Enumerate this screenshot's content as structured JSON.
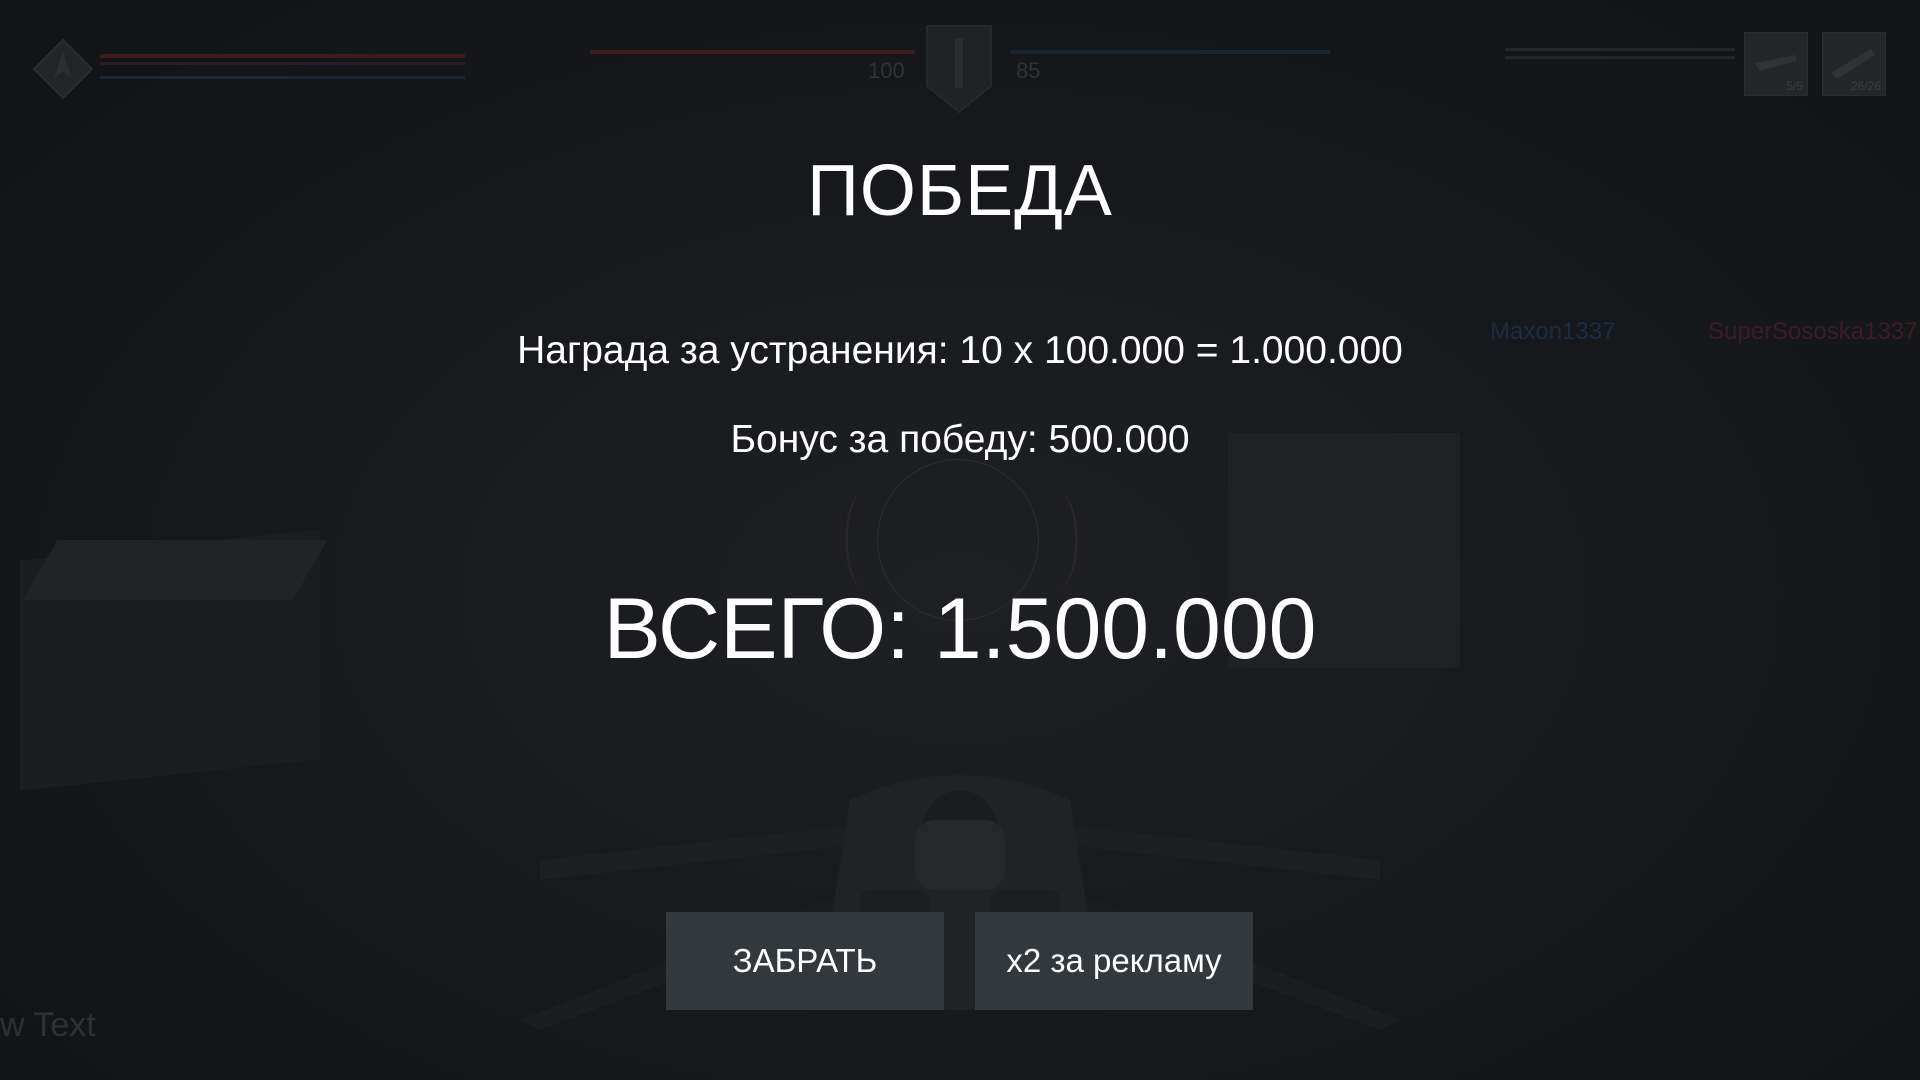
{
  "hud": {
    "team_red_score": "100",
    "team_blue_score": "85",
    "weapon_slots": [
      {
        "icon": "rifle-icon",
        "count": "5/5"
      },
      {
        "icon": "missile-icon",
        "count": "26/26"
      }
    ]
  },
  "scene": {
    "player_names": [
      "Maxon1337",
      "SuperSososka1337"
    ],
    "debug_text": "w Text"
  },
  "results": {
    "title": "ПОБЕДА",
    "kills_reward": "Награда за устранения:  10 x 100.000 = 1.000.000",
    "victory_bonus": "Бонус за победу:  500.000",
    "total": "ВСЕГО: 1.500.000"
  },
  "buttons": {
    "claim_label": "ЗАБРАТЬ",
    "double_ad_label": "x2 за рекламу"
  },
  "colors": {
    "overlay_bg": "#15171a",
    "button_bg": "#33383c",
    "text": "#ffffff",
    "team_red": "#3b1d20",
    "team_blue": "#1a2438"
  }
}
